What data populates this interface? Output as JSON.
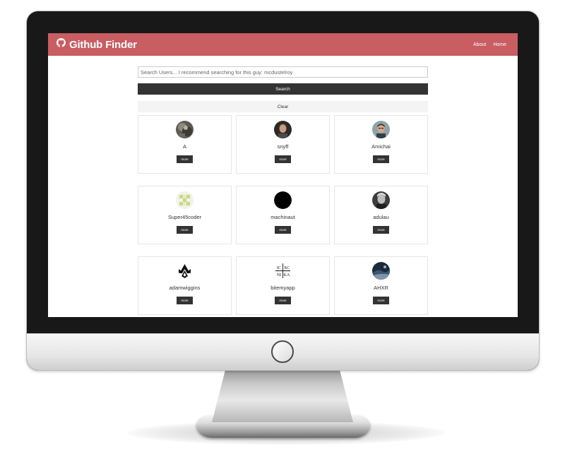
{
  "app": {
    "title": "Github Finder",
    "brand_icon": "github-octocat-icon",
    "accent_color": "#c85d62"
  },
  "nav": {
    "links": [
      "About",
      "Home"
    ]
  },
  "search": {
    "placeholder": "Search Users... I recommend searching for this guy: mcdustelroy",
    "value": "",
    "search_label": "Search",
    "clear_label": "Clear"
  },
  "users": [
    {
      "login": "A",
      "more_label": "more",
      "avatar_icon": "photo-avatar-icon"
    },
    {
      "login": "snyff",
      "more_label": "more",
      "avatar_icon": "photo-avatar-icon"
    },
    {
      "login": "Amichai",
      "more_label": "more",
      "avatar_icon": "photo-avatar-icon"
    },
    {
      "login": "Super45coder",
      "more_label": "more",
      "avatar_icon": "identicon-avatar-icon"
    },
    {
      "login": "machinaut",
      "more_label": "more",
      "avatar_icon": "black-circle-avatar-icon"
    },
    {
      "login": "adulau",
      "more_label": "more",
      "avatar_icon": "photo-avatar-icon"
    },
    {
      "login": "adamwiggins",
      "more_label": "more",
      "avatar_icon": "geometric-logo-avatar-icon"
    },
    {
      "login": "bitemyapp",
      "more_label": "more",
      "avatar_icon": "glyph-grid-avatar-icon"
    },
    {
      "login": "AHXR",
      "more_label": "more",
      "avatar_icon": "photo-avatar-icon"
    }
  ],
  "avatar_glyphs": {
    "top_left": "IC",
    "top_right": "XC",
    "bottom_left": "NI",
    "bottom_right": "KA"
  }
}
